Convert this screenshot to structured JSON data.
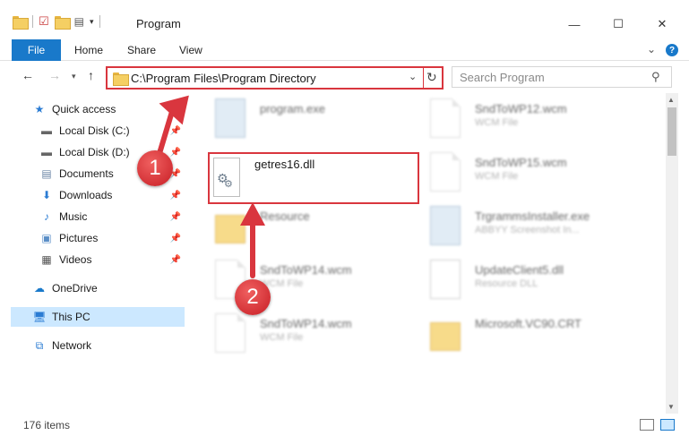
{
  "window": {
    "title": "Program",
    "minimize": "—",
    "maximize": "☐",
    "close": "✕"
  },
  "ribbon": {
    "tabs": [
      "File",
      "Home",
      "Share",
      "View"
    ],
    "expand": "⌄",
    "help": "?"
  },
  "address": {
    "path": "C:\\Program Files\\Program Directory",
    "search_placeholder": "Search Program"
  },
  "nav_pane": {
    "items": [
      {
        "label": "Quick access",
        "icon": "star-icon",
        "pinned": false
      },
      {
        "label": "Local Disk (C:)",
        "icon": "drive-icon",
        "pinned": true
      },
      {
        "label": "Local Disk (D:)",
        "icon": "drive-icon",
        "pinned": true
      },
      {
        "label": "Documents",
        "icon": "documents-icon",
        "pinned": true
      },
      {
        "label": "Downloads",
        "icon": "download-icon",
        "pinned": true
      },
      {
        "label": "Music",
        "icon": "music-icon",
        "pinned": true
      },
      {
        "label": "Pictures",
        "icon": "pictures-icon",
        "pinned": true
      },
      {
        "label": "Videos",
        "icon": "videos-icon",
        "pinned": true
      },
      {
        "label": "OneDrive",
        "icon": "cloud-icon",
        "pinned": false
      },
      {
        "label": "This PC",
        "icon": "computer-icon",
        "pinned": false
      },
      {
        "label": "Network",
        "icon": "network-icon",
        "pinned": false
      }
    ],
    "selected": "This PC"
  },
  "files": [
    {
      "name": "program.exe",
      "type": "",
      "kind": "exe"
    },
    {
      "name": "SndToWP12.wcm",
      "type": "WCM File",
      "kind": "doc"
    },
    {
      "name": "getres16.dll",
      "type": "",
      "kind": "dll"
    },
    {
      "name": "SndToWP15.wcm",
      "type": "WCM File",
      "kind": "doc"
    },
    {
      "name": "Resource",
      "type": "",
      "kind": "folder"
    },
    {
      "name": "TrgrammsInstaller.exe",
      "type": "ABBYY Screenshot In...",
      "kind": "exe"
    },
    {
      "name": "SndToWP14.wcm",
      "type": "WCM File",
      "kind": "doc"
    },
    {
      "name": "UpdateClient5.dll",
      "type": "Resource DLL",
      "kind": "dll"
    },
    {
      "name": "SndToWP14.wcm",
      "type": "WCM File",
      "kind": "doc"
    },
    {
      "name": "Microsoft.VC90.CRT",
      "type": "",
      "kind": "folder"
    }
  ],
  "status": {
    "item_count": "176 items"
  },
  "annotations": {
    "step1": "1",
    "step2": "2"
  },
  "colors": {
    "accent": "#1979ca",
    "annotation_red": "#d9363e",
    "selection": "#cce8ff"
  }
}
